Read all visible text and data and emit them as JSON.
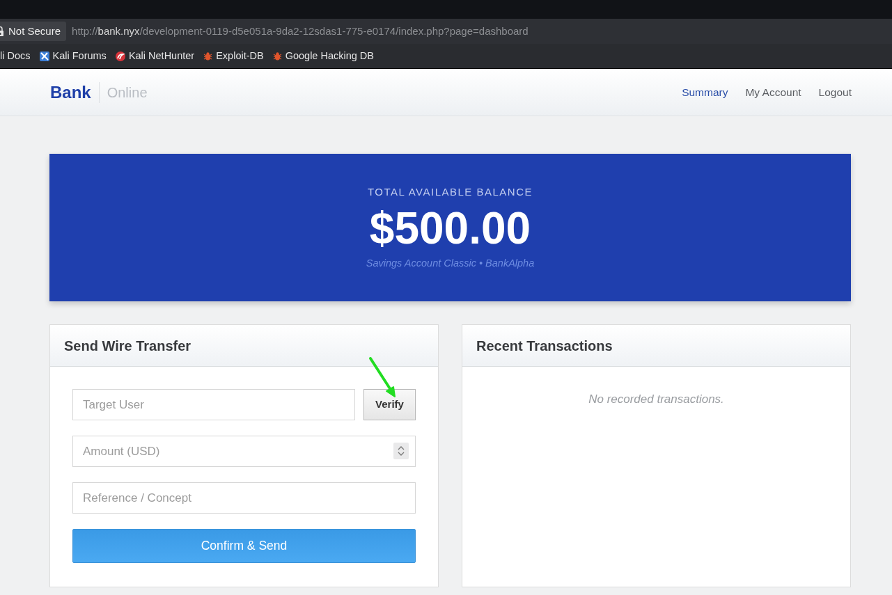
{
  "browser": {
    "security_label": "Not Secure",
    "url": {
      "scheme": "http://",
      "host": "bank.nyx",
      "path": "/development-0119-d5e051a-9da2-12sdas1-775-e0174/index.php?page=dashboard"
    },
    "bookmarks": [
      {
        "label": "li Docs",
        "kind": "plain"
      },
      {
        "label": "Kali Forums",
        "kind": "tile"
      },
      {
        "label": "Kali NetHunter",
        "kind": "swirl"
      },
      {
        "label": "Exploit-DB",
        "kind": "bug"
      },
      {
        "label": "Google Hacking DB",
        "kind": "bug"
      }
    ]
  },
  "header": {
    "brand": "Bank",
    "brand_suffix": "Online",
    "nav": [
      {
        "label": "Summary",
        "selected": true
      },
      {
        "label": "My Account",
        "selected": false
      },
      {
        "label": "Logout",
        "selected": false
      }
    ]
  },
  "balance": {
    "label": "TOTAL AVAILABLE BALANCE",
    "amount": "$500.00",
    "account": "Savings Account Classic • BankAlpha"
  },
  "transfer": {
    "title": "Send Wire Transfer",
    "target_field": {
      "placeholder": "Target User"
    },
    "verify_button": "Verify",
    "amount_field": {
      "placeholder": "Amount (USD)"
    },
    "reference_field": {
      "placeholder": "Reference / Concept"
    },
    "submit_button": "Confirm & Send"
  },
  "transactions": {
    "title": "Recent Transactions",
    "empty_message": "No recorded transactions."
  }
}
